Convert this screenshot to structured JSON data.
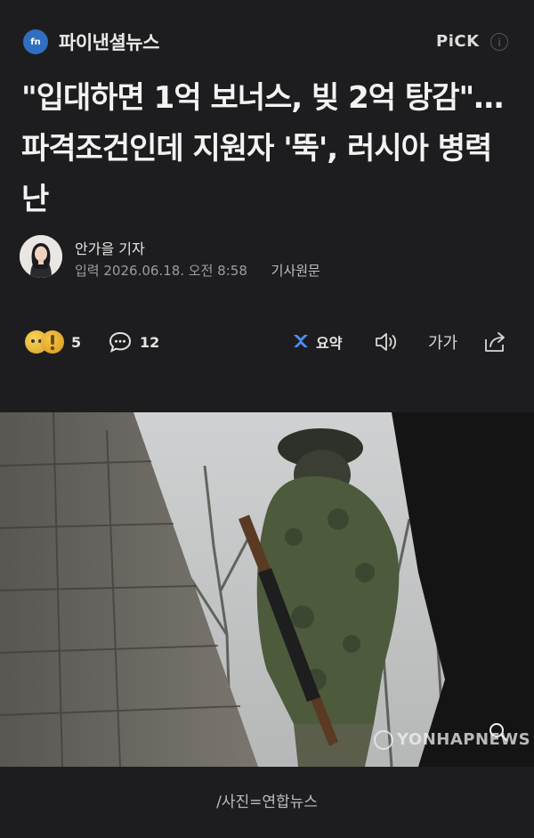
{
  "header": {
    "press_logo_text": "fn",
    "press_name": "파이낸셜뉴스",
    "pick_label": "PiCK"
  },
  "article": {
    "title": "\"입대하면 1억 보너스, 빚 2억 탕감\"…파격조건인데 지원자 '뚝', 러시아 병력난",
    "author": "안가을 기자",
    "input_label": "입력",
    "datetime": "2026.06.18. 오전 8:58",
    "original_link": "기사원문"
  },
  "actions": {
    "reaction_count": "5",
    "comment_count": "12",
    "summary_label": "요약",
    "font_label": "가가"
  },
  "photo": {
    "watermark": "YONHAPNEWS",
    "caption": "/사진=연합뉴스"
  },
  "colors": {
    "background": "#1d1d1f",
    "accent_blue": "#2f6fc1"
  }
}
